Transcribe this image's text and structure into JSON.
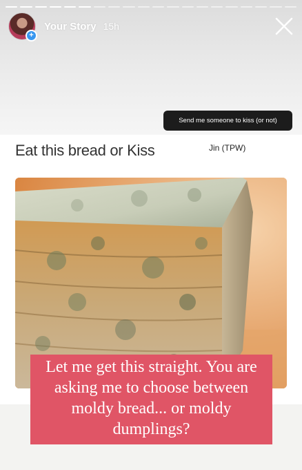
{
  "story": {
    "username": "Your Story",
    "time": "15h",
    "segments_total": 20,
    "segments_viewed": 6
  },
  "tooltip": {
    "text": "Send me someone to kiss (or not)"
  },
  "meme": {
    "title": "Eat this bread or Kiss",
    "user": "Jin (TPW)"
  },
  "caption": {
    "text": "Let me get this straight. You are asking me to choose between moldy bread... or moldy dumplings?",
    "background": "#e05566"
  },
  "icons": {
    "close": "close-icon",
    "add": "plus-icon"
  }
}
